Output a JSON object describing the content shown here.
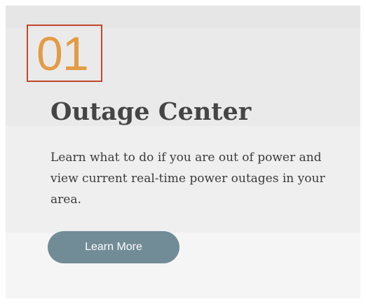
{
  "card": {
    "step_number": "01",
    "title": "Outage Center",
    "description": "Learn what to do if you are out of power and view current real-time power outages in your area.",
    "button_label": "Learn More"
  },
  "colors": {
    "step_number": "#e39b45",
    "highlight_border": "#c2472d",
    "title": "#454545",
    "button_bg": "#718c97",
    "button_text": "#ffffff"
  }
}
